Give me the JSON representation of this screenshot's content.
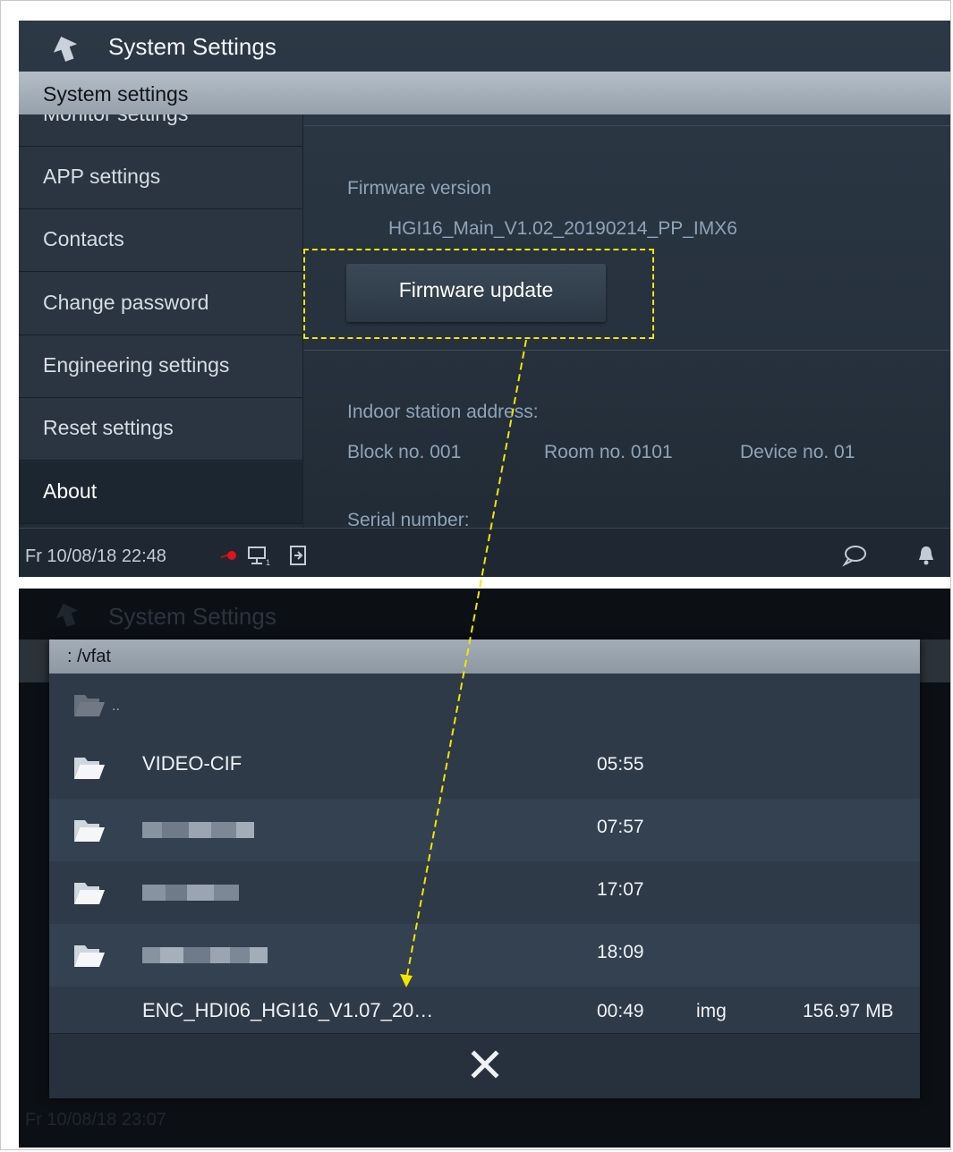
{
  "top_screen": {
    "app_title": "System Settings",
    "tab_label": "System settings",
    "menu": [
      {
        "label": "Monitor settings"
      },
      {
        "label": "APP settings"
      },
      {
        "label": "Contacts"
      },
      {
        "label": "Change password"
      },
      {
        "label": "Engineering settings"
      },
      {
        "label": "Reset settings"
      },
      {
        "label": "About"
      }
    ],
    "firmware_version_label": "Firmware version",
    "firmware_version_value": "HGI16_Main_V1.02_20190214_PP_IMX6",
    "firmware_update_button": "Firmware update",
    "address_label": "Indoor station address:",
    "block_label": "Block no.  001",
    "room_label": "Room no.  0101",
    "device_label": "Device no.  01",
    "serial_label": "Serial number:",
    "status_datetime": "Fr 10/08/18  22:48",
    "icons": [
      "back-arrow-icon",
      "record-dot-icon",
      "monitor-icon",
      "exit-door-icon",
      "chat-bubble-icon",
      "bell-icon"
    ]
  },
  "bottom_screen": {
    "bg_title": "System Settings",
    "bg_status": "Fr 10/08/18  23:07",
    "dialog_path": ": /vfat",
    "parent_dir": "..",
    "files": [
      {
        "name": "VIDEO-CIF",
        "time": "05:55",
        "type": "",
        "size": "",
        "folder": true
      },
      {
        "name": "",
        "time": "07:57",
        "type": "",
        "size": "",
        "folder": true
      },
      {
        "name": "",
        "time": "17:07",
        "type": "",
        "size": "",
        "folder": true
      },
      {
        "name": "",
        "time": "18:09",
        "type": "",
        "size": "",
        "folder": true
      },
      {
        "name": "ENC_HDI06_HGI16_V1.07_20…",
        "time": "00:49",
        "type": "img",
        "size": "156.97 MB",
        "folder": false
      }
    ],
    "icons": [
      "folder-icon",
      "close-x-icon"
    ]
  },
  "colors": {
    "highlight": "#f2e600",
    "screen_bg": "#26313d",
    "tab_bar": "#a5afb9"
  }
}
